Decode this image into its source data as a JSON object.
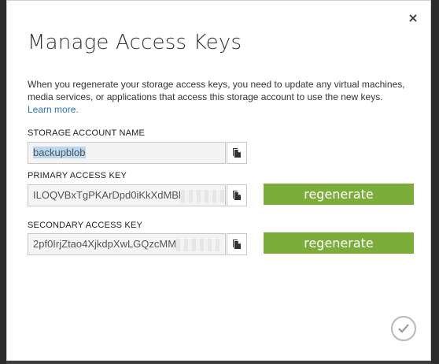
{
  "dialog": {
    "title": "Manage Access Keys",
    "description": "When you regenerate your storage access keys, you need to update any virtual machines, media services, or applications that access this storage account to use the new keys.",
    "learn_more": "Learn more."
  },
  "storage_account": {
    "label": "STORAGE ACCOUNT NAME",
    "value": "backupblob"
  },
  "primary_key": {
    "label": "PRIMARY ACCESS KEY",
    "value": "ILOQVBxTgPKArDpd0iKkXdMBl",
    "regenerate_label": "regenerate"
  },
  "secondary_key": {
    "label": "SECONDARY ACCESS KEY",
    "value": "2pf0IrjZtao4XjkdpXwLGQzcMM",
    "regenerate_label": "regenerate"
  },
  "colors": {
    "accent_green": "#7cad3a",
    "link_blue": "#2a73b5"
  },
  "icons": {
    "close": "close-icon",
    "copy": "copy-icon",
    "confirm": "checkmark-icon"
  }
}
